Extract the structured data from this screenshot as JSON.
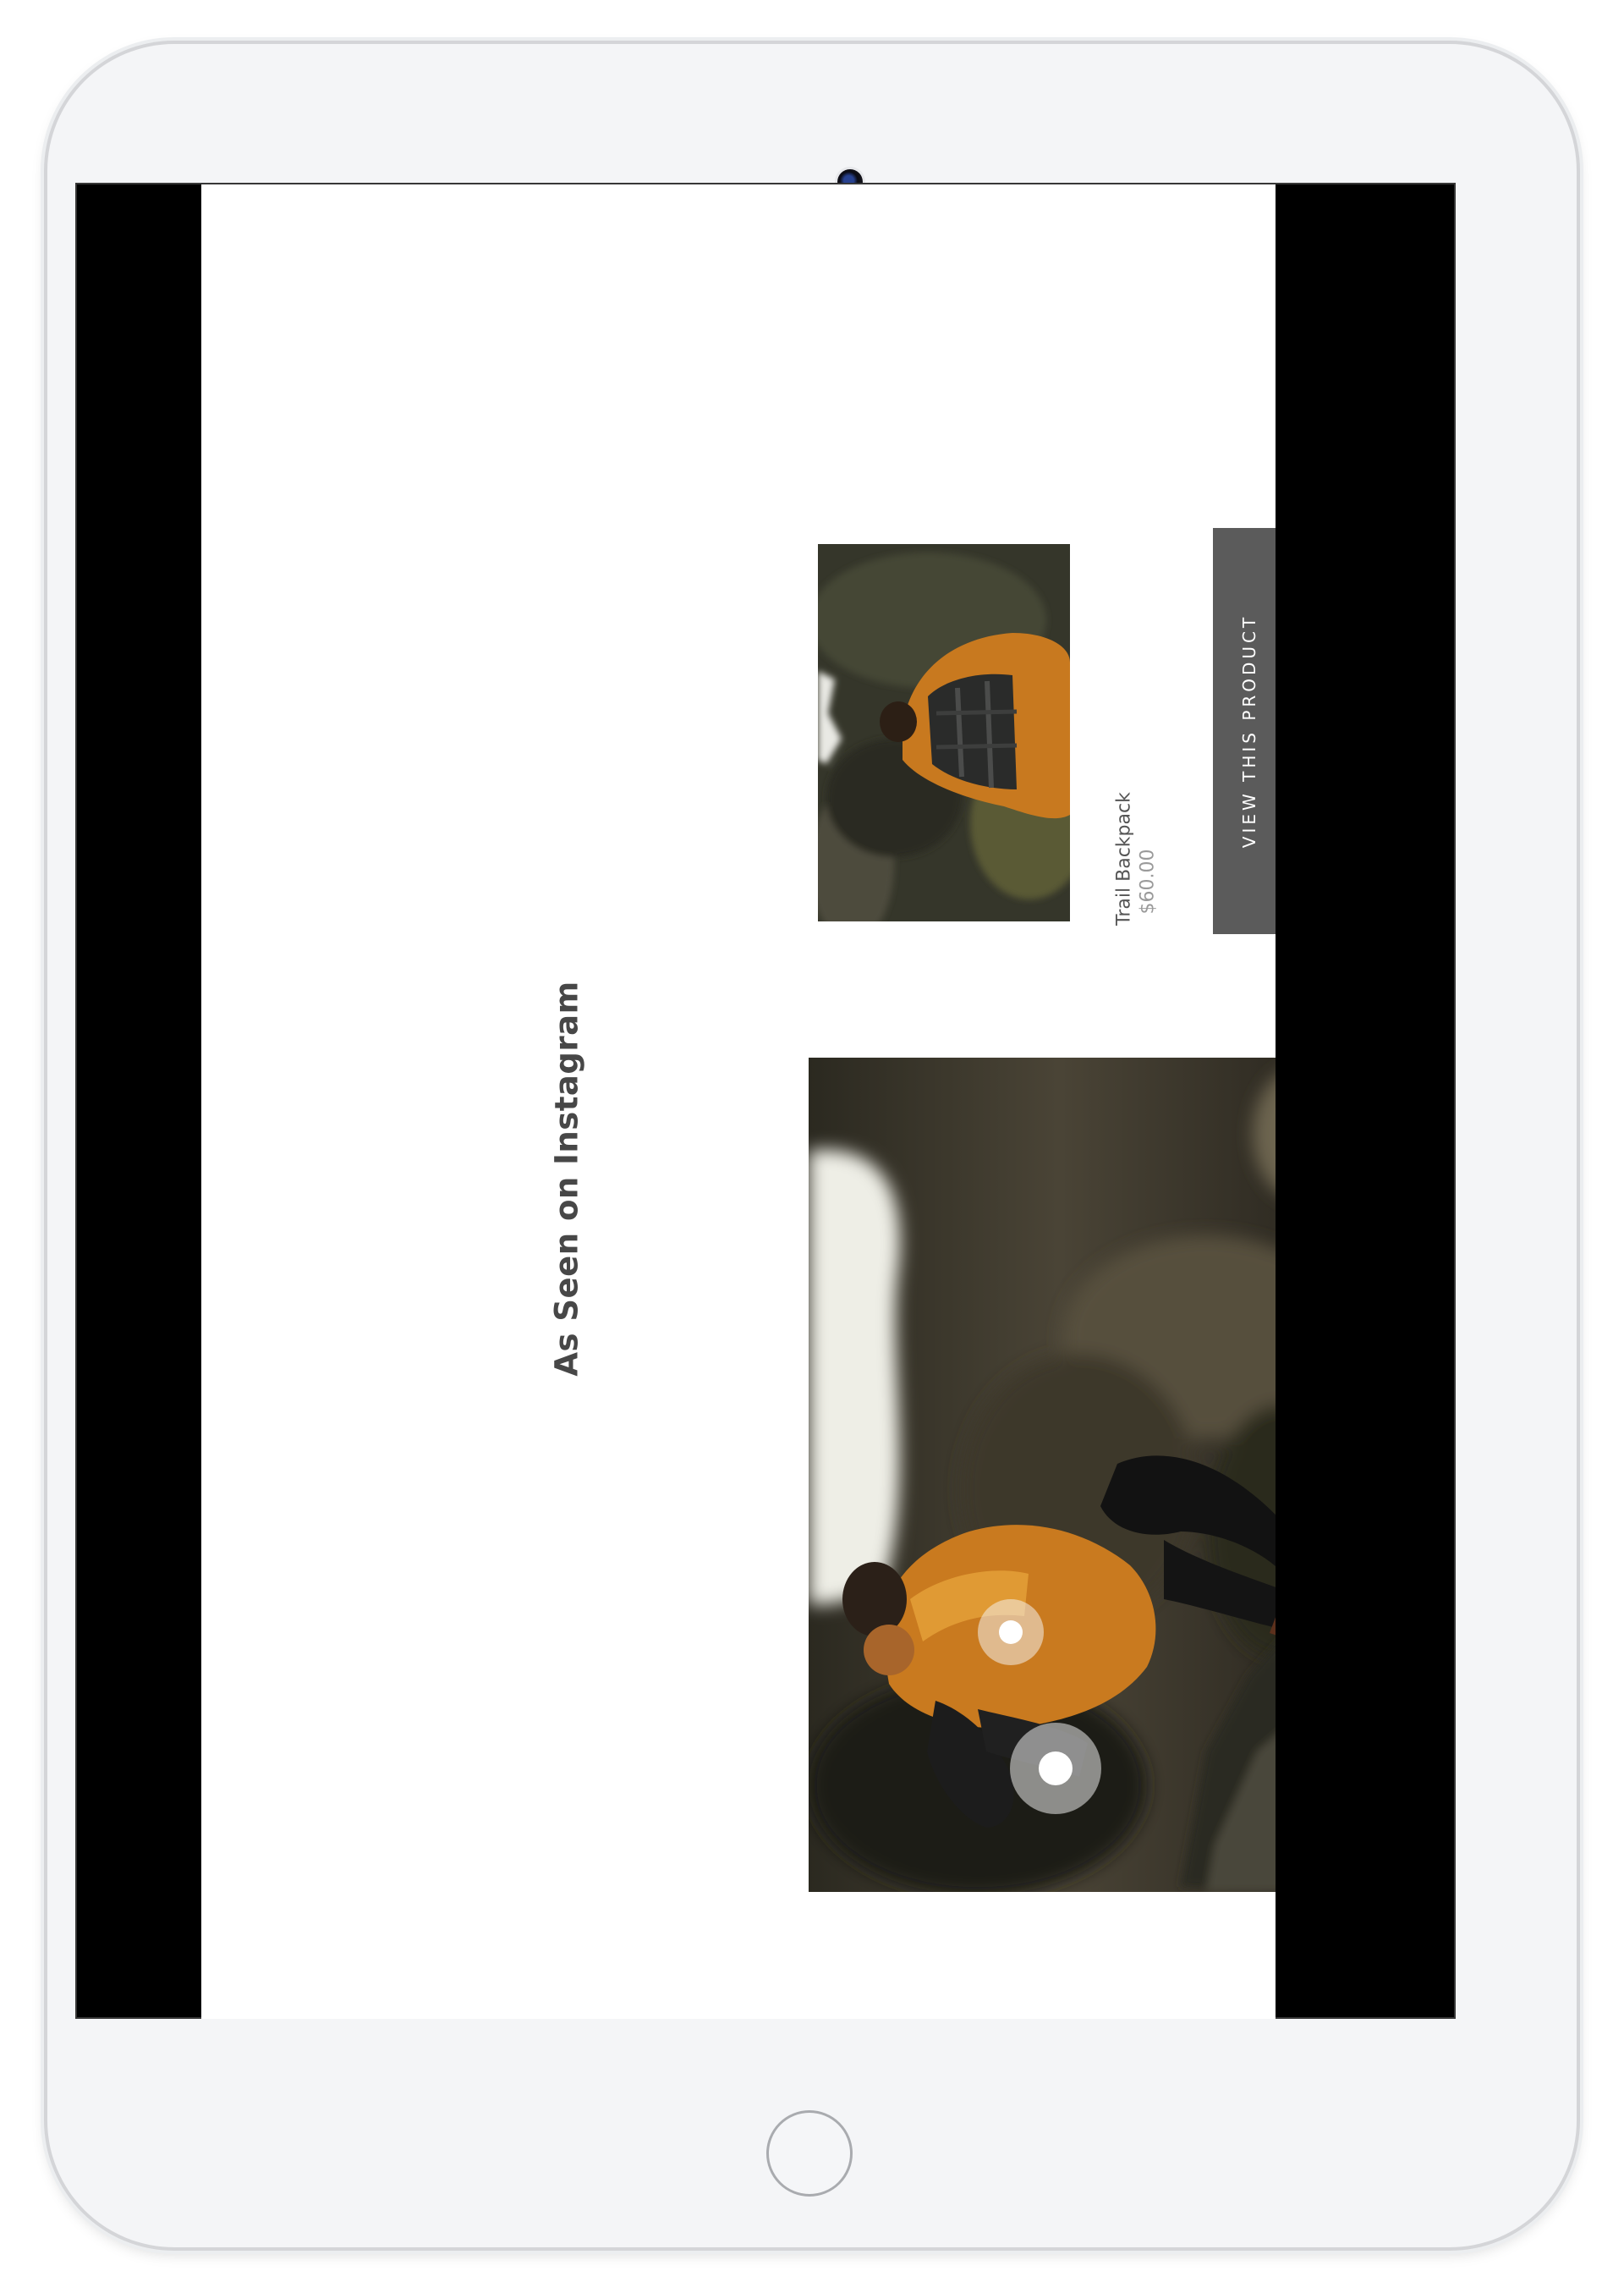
{
  "section": {
    "title": "As Seen on Instagram"
  },
  "product": {
    "name": "Trail Backpack",
    "price": "$60.00",
    "button_label": "VIEW THIS PRODUCT"
  },
  "carousel": {
    "active_slide": 1,
    "slide_count": 2
  },
  "colors": {
    "button_background": "#5b5b5b",
    "active_dot": "#555555",
    "title_text": "#474747"
  }
}
